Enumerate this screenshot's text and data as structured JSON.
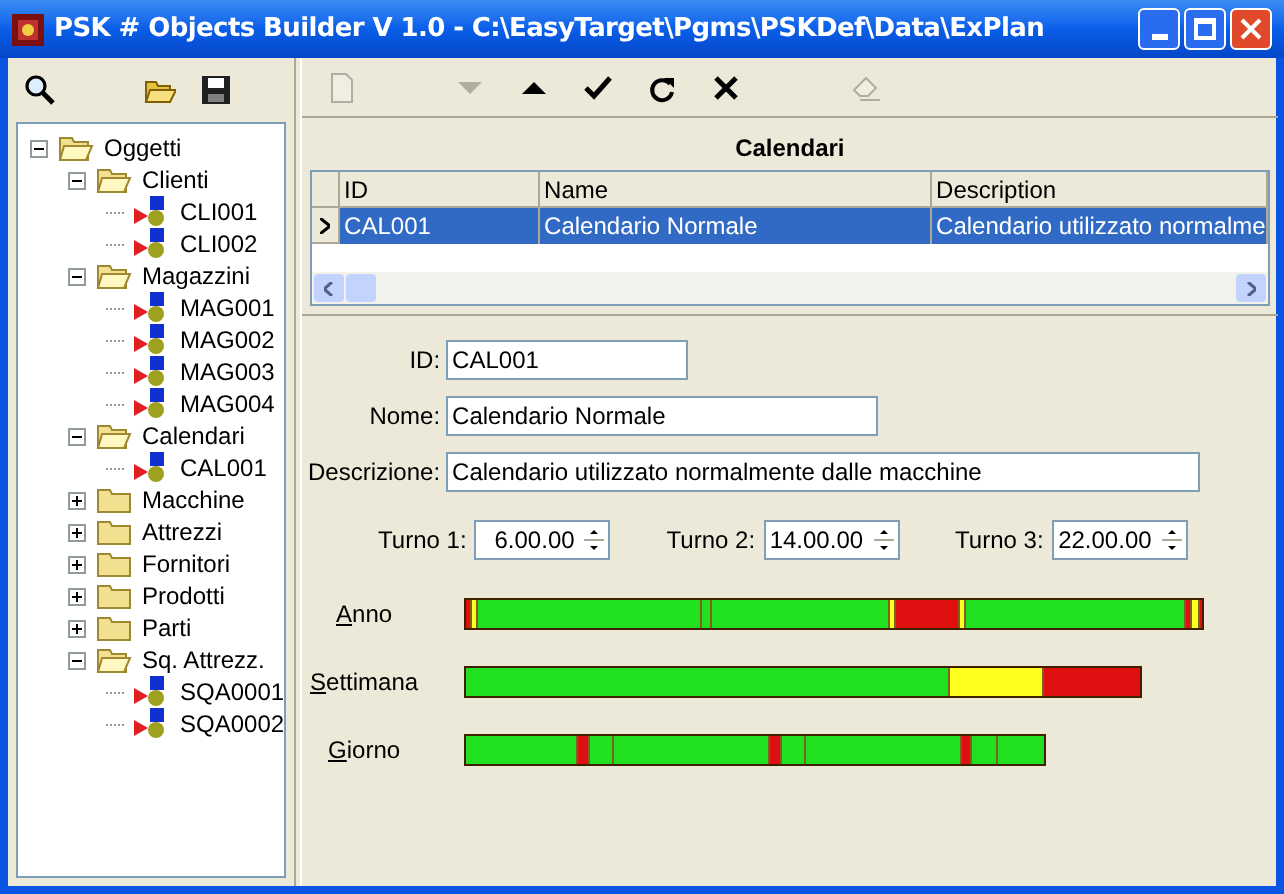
{
  "window": {
    "title": "PSK # Objects Builder V 1.0 - C:\\EasyTarget\\Pgms\\PSKDef\\Data\\ExPlan"
  },
  "left_toolbar": [
    {
      "disabled": false
    },
    {
      "disabled": false
    },
    {
      "disabled": false
    }
  ],
  "tree": [
    {
      "label": "Oggetti",
      "kind": "folder",
      "expanded": true,
      "children": [
        {
          "label": "Clienti",
          "kind": "folder",
          "expanded": true,
          "children": [
            {
              "label": "CLI001",
              "kind": "object"
            },
            {
              "label": "CLI002",
              "kind": "object"
            }
          ]
        },
        {
          "label": "Magazzini",
          "kind": "folder",
          "expanded": true,
          "children": [
            {
              "label": "MAG001",
              "kind": "object"
            },
            {
              "label": "MAG002",
              "kind": "object"
            },
            {
              "label": "MAG003",
              "kind": "object"
            },
            {
              "label": "MAG004",
              "kind": "object"
            }
          ]
        },
        {
          "label": "Calendari",
          "kind": "folder",
          "expanded": true,
          "children": [
            {
              "label": "CAL001",
              "kind": "object"
            }
          ]
        },
        {
          "label": "Macchine",
          "kind": "folder",
          "expanded": false
        },
        {
          "label": "Attrezzi",
          "kind": "folder",
          "expanded": false
        },
        {
          "label": "Fornitori",
          "kind": "folder",
          "expanded": false
        },
        {
          "label": "Prodotti",
          "kind": "folder",
          "expanded": false
        },
        {
          "label": "Parti",
          "kind": "folder",
          "expanded": false
        },
        {
          "label": "Sq. Attrezz.",
          "kind": "folder",
          "expanded": true,
          "children": [
            {
              "label": "SQA0001",
              "kind": "object"
            },
            {
              "label": "SQA0002",
              "kind": "object"
            }
          ]
        }
      ]
    }
  ],
  "right_toolbar": [
    {
      "disabled": true
    },
    {
      "disabled": true
    },
    {
      "disabled": false
    },
    {
      "disabled": false
    },
    {
      "disabled": false
    },
    {
      "disabled": false
    },
    {
      "disabled": true
    }
  ],
  "grid": {
    "title": "Calendari",
    "columns": [
      "ID",
      "Name",
      "Description"
    ],
    "rows": [
      {
        "cells": [
          "CAL001",
          "Calendario Normale",
          "Calendario utilizzato normalme"
        ],
        "selected": true
      }
    ]
  },
  "form": {
    "id": {
      "label": "ID:",
      "value": "CAL001"
    },
    "name": {
      "label": "Nome:",
      "value": "Calendario Normale"
    },
    "description": {
      "label": "Descrizione:",
      "value": "Calendario utilizzato normalmente dalle macchine"
    },
    "shifts": [
      {
        "label": "Turno 1:",
        "value": "6.00.00"
      },
      {
        "label": "Turno 2:",
        "value": "14.00.00"
      },
      {
        "label": "Turno 3:",
        "value": "22.00.00"
      }
    ],
    "timelines": [
      {
        "label": "Anno",
        "kind": "year"
      },
      {
        "label": "Settimana",
        "kind": "week"
      },
      {
        "label": "Giorno",
        "kind": "day"
      }
    ]
  }
}
